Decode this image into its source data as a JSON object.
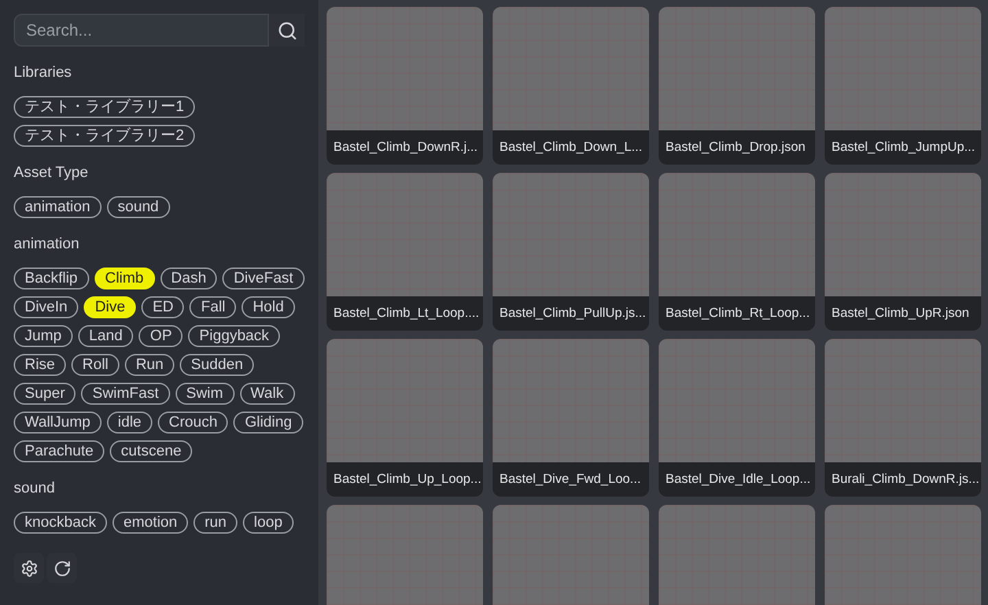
{
  "search": {
    "placeholder": "Search..."
  },
  "sections": [
    {
      "title": "Libraries",
      "tags": [
        {
          "label": "テスト・ライブラリー1",
          "selected": false
        },
        {
          "label": "テスト・ライブラリー2",
          "selected": false
        }
      ]
    },
    {
      "title": "Asset Type",
      "tags": [
        {
          "label": "animation",
          "selected": false
        },
        {
          "label": "sound",
          "selected": false
        }
      ]
    },
    {
      "title": "animation",
      "tags": [
        {
          "label": "Backflip",
          "selected": false
        },
        {
          "label": "Climb",
          "selected": true
        },
        {
          "label": "Dash",
          "selected": false
        },
        {
          "label": "DiveFast",
          "selected": false
        },
        {
          "label": "DiveIn",
          "selected": false
        },
        {
          "label": "Dive",
          "selected": true
        },
        {
          "label": "ED",
          "selected": false
        },
        {
          "label": "Fall",
          "selected": false
        },
        {
          "label": "Hold",
          "selected": false
        },
        {
          "label": "Jump",
          "selected": false
        },
        {
          "label": "Land",
          "selected": false
        },
        {
          "label": "OP",
          "selected": false
        },
        {
          "label": "Piggyback",
          "selected": false
        },
        {
          "label": "Rise",
          "selected": false
        },
        {
          "label": "Roll",
          "selected": false
        },
        {
          "label": "Run",
          "selected": false
        },
        {
          "label": "Sudden",
          "selected": false
        },
        {
          "label": "Super",
          "selected": false
        },
        {
          "label": "SwimFast",
          "selected": false
        },
        {
          "label": "Swim",
          "selected": false
        },
        {
          "label": "Walk",
          "selected": false
        },
        {
          "label": "WallJump",
          "selected": false
        },
        {
          "label": "idle",
          "selected": false
        },
        {
          "label": "Crouch",
          "selected": false
        },
        {
          "label": "Gliding",
          "selected": false
        },
        {
          "label": "Parachute",
          "selected": false
        },
        {
          "label": "cutscene",
          "selected": false
        }
      ]
    },
    {
      "title": "sound",
      "tags": [
        {
          "label": "knockback",
          "selected": false
        },
        {
          "label": "emotion",
          "selected": false
        },
        {
          "label": "run",
          "selected": false
        },
        {
          "label": "loop",
          "selected": false
        }
      ]
    }
  ],
  "assets": [
    {
      "name": "Bastel_Climb_DownR.j..."
    },
    {
      "name": "Bastel_Climb_Down_L..."
    },
    {
      "name": "Bastel_Climb_Drop.json"
    },
    {
      "name": "Bastel_Climb_JumpUp..."
    },
    {
      "name": "Bastel_Climb_Lt_Loop...."
    },
    {
      "name": "Bastel_Climb_PullUp.js..."
    },
    {
      "name": "Bastel_Climb_Rt_Loop..."
    },
    {
      "name": "Bastel_Climb_UpR.json"
    },
    {
      "name": "Bastel_Climb_Up_Loop..."
    },
    {
      "name": "Bastel_Dive_Fwd_Loo..."
    },
    {
      "name": "Bastel_Dive_Idle_Loop..."
    },
    {
      "name": "Burali_Climb_DownR.js..."
    },
    {
      "kind": "cut_off"
    },
    {
      "kind": "cut_off"
    },
    {
      "kind": "cut_off"
    },
    {
      "kind": "cut_off"
    }
  ]
}
